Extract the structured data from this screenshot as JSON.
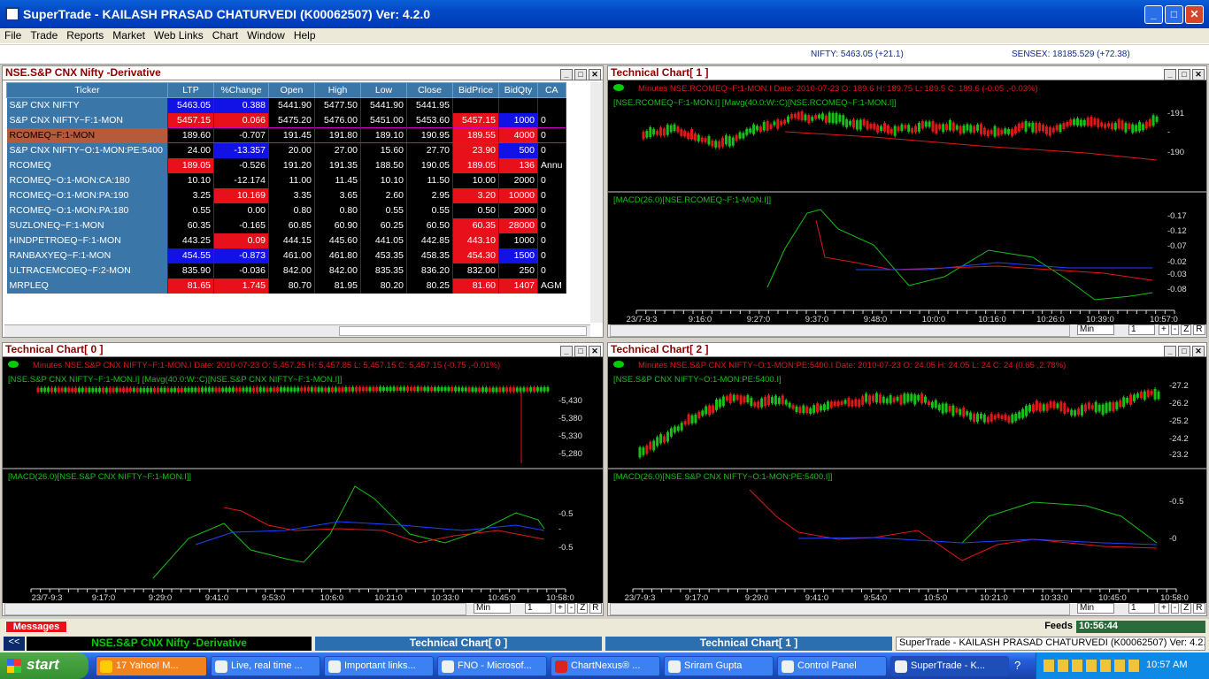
{
  "app": {
    "title": "SuperTrade - KAILASH PRASAD CHATURVEDI  (K00062507)    Ver: 4.2.0"
  },
  "menu": [
    "File",
    "Trade",
    "Reports",
    "Market",
    "Web Links",
    "Chart",
    "Window",
    "Help"
  ],
  "indices": {
    "nifty": "NIFTY: 5463.05 (+21.1)",
    "sensex": "SENSEX: 18185.529 (+72.38)"
  },
  "watch": {
    "title": "NSE.S&P CNX Nifty -Derivative",
    "columns": [
      "Ticker",
      "LTP",
      "%Change",
      "Open",
      "High",
      "Low",
      "Close",
      "BidPrice",
      "BidQty",
      "CA"
    ],
    "rows": [
      [
        "S&P CNX NIFTY",
        "5463.05",
        "0.388",
        "5441.90",
        "5477.50",
        "5441.90",
        "5441.95",
        "",
        "",
        ""
      ],
      [
        "S&P CNX NIFTY~F:1-MON",
        "5457.15",
        "0.066",
        "5475.20",
        "5476.00",
        "5451.00",
        "5453.60",
        "5457.15",
        "1000",
        "0"
      ],
      [
        "RCOMEQ~F:1-MON",
        "189.60",
        "-0.707",
        "191.45",
        "191.80",
        "189.10",
        "190.95",
        "189.55",
        "4000",
        "0"
      ],
      [
        "S&P CNX NIFTY~O:1-MON:PE:5400",
        "24.00",
        "-13.357",
        "20.00",
        "27.00",
        "15.60",
        "27.70",
        "23.90",
        "500",
        "0"
      ],
      [
        "RCOMEQ",
        "189.05",
        "-0.526",
        "191.20",
        "191.35",
        "188.50",
        "190.05",
        "189.05",
        "136",
        "Annu"
      ],
      [
        "RCOMEQ~O:1-MON:CA:180",
        "10.10",
        "-12.174",
        "11.00",
        "11.45",
        "10.10",
        "11.50",
        "10.00",
        "2000",
        "0"
      ],
      [
        "RCOMEQ~O:1-MON:PA:190",
        "3.25",
        "10.169",
        "3.35",
        "3.65",
        "2.60",
        "2.95",
        "3.20",
        "10000",
        "0"
      ],
      [
        "RCOMEQ~O:1-MON:PA:180",
        "0.55",
        "0.00",
        "0.80",
        "0.80",
        "0.55",
        "0.55",
        "0.50",
        "2000",
        "0"
      ],
      [
        "SUZLONEQ~F:1-MON",
        "60.35",
        "-0.165",
        "60.85",
        "60.90",
        "60.25",
        "60.50",
        "60.35",
        "28000",
        "0"
      ],
      [
        "HINDPETROEQ~F:1-MON",
        "443.25",
        "0.09",
        "444.15",
        "445.60",
        "441.05",
        "442.85",
        "443.10",
        "1000",
        "0"
      ],
      [
        "RANBAXYEQ~F:1-MON",
        "454.55",
        "-0.873",
        "461.00",
        "461.80",
        "453.35",
        "458.35",
        "454.30",
        "1500",
        "0"
      ],
      [
        "ULTRACEMCOEQ~F:2-MON",
        "835.90",
        "-0.036",
        "842.00",
        "842.00",
        "835.35",
        "836.20",
        "832.00",
        "250",
        "0"
      ],
      [
        "MRPLEQ",
        "81.65",
        "1.745",
        "80.70",
        "81.95",
        "80.20",
        "80.25",
        "81.60",
        "1407",
        "AGM"
      ]
    ]
  },
  "chart1": {
    "title": "Technical Chart[ 1 ]",
    "info": "Minutes NSE.RCOMEQ~F:1-MON.I Date: 2010-07-23 O: 189.6 H: 189.75 L: 189.5 C: 189.6  (-0.05 ,-0.03%)",
    "legend": "[NSE.RCOMEQ~F:1-MON.I] [Mavg(40.0:W::C)[NSE.RCOMEQ~F:1-MON.I]]",
    "macd": "[MACD(26.0)[NSE.RCOMEQ~F:1-MON.I]]",
    "yticks": [
      "-191",
      "-",
      "-190"
    ],
    "macd_ticks": [
      "-0.17",
      "-0.12",
      "-0.07",
      "-0.02",
      "-0.03",
      "-0.08"
    ],
    "xticks": [
      "23/7-9:3",
      "9:16:0",
      "9:27:0",
      "9:37:0",
      "9:48:0",
      "10:0:0",
      "10:16:0",
      "10:26:0",
      "10:39:0",
      "10:57:0"
    ],
    "period": "Min",
    "interval": "1"
  },
  "chart0": {
    "title": "Technical Chart[ 0 ]",
    "info": "Minutes NSE.S&P CNX NIFTY~F:1-MON.I Date: 2010-07-23 O: 5,457.25 H: 5,457.85 L: 5,457.15 C: 5,457.15  (-0.75 ,-0.01%)",
    "legend": "[NSE.S&P CNX NIFTY~F:1-MON.I] [Mavg(40.0:W::C)[NSE.S&P CNX NIFTY~F:1-MON.I]]",
    "macd": "[MACD(26.0)[NSE.S&P CNX NIFTY~F:1-MON.I]]",
    "yticks": [
      "-5,430",
      "-5,380",
      "-5,330",
      "-5,280"
    ],
    "macd_ticks": [
      "-0.5",
      "-",
      "-0.5"
    ],
    "xticks": [
      "23/7-9:3",
      "9:17:0",
      "9:29:0",
      "9:41:0",
      "9:53:0",
      "10:6:0",
      "10:21:0",
      "10:33:0",
      "10:45:0",
      "10:58:0"
    ],
    "period": "Min",
    "interval": "1"
  },
  "chart2": {
    "title": "Technical Chart[ 2 ]",
    "info": "Minutes NSE.S&P CNX NIFTY~O:1-MON:PE:5400.I Date: 2010-07-23 O: 24.05 H: 24.05 L: 24 C: 24  (0.65 ,2.78%)",
    "legend": "[NSE.S&P CNX NIFTY~O:1-MON:PE:5400.I]",
    "macd": "[MACD(26.0)[NSE.S&P CNX NIFTY~O:1-MON:PE:5400.I]]",
    "yticks": [
      "-27.2",
      "-26.2",
      "-25.2",
      "-24.2",
      "-23.2"
    ],
    "macd_ticks": [
      "-0.5",
      "-0"
    ],
    "xticks": [
      "23/7-9:3",
      "9:17:0",
      "9:29:0",
      "9:41:0",
      "9:54:0",
      "10:5:0",
      "10:21:0",
      "10:33:0",
      "10:45:0",
      "10:58:0"
    ],
    "period": "Min",
    "interval": "1"
  },
  "chart_buttons": [
    "+",
    "-",
    "Z",
    "R"
  ],
  "messages": {
    "label": "Messages",
    "feeds": "Feeds",
    "time": "10:56:44"
  },
  "tabs": [
    "<<",
    "NSE.S&P CNX Nifty -Derivative",
    "Technical Chart[ 0 ]",
    "Technical Chart[ 1 ]"
  ],
  "statusright": "SuperTrade - KAILASH PRASAD CHATURVEDI  (K00062507)    Ver: 4.2.0",
  "taskbar": {
    "start": "start",
    "items": [
      "17 Yahoo! M...",
      "Live, real time ...",
      "Important links...",
      "FNO - Microsof...",
      "ChartNexus® ...",
      "Sriram Gupta",
      "Control Panel",
      "SuperTrade - K..."
    ],
    "clock": "10:57 AM"
  }
}
